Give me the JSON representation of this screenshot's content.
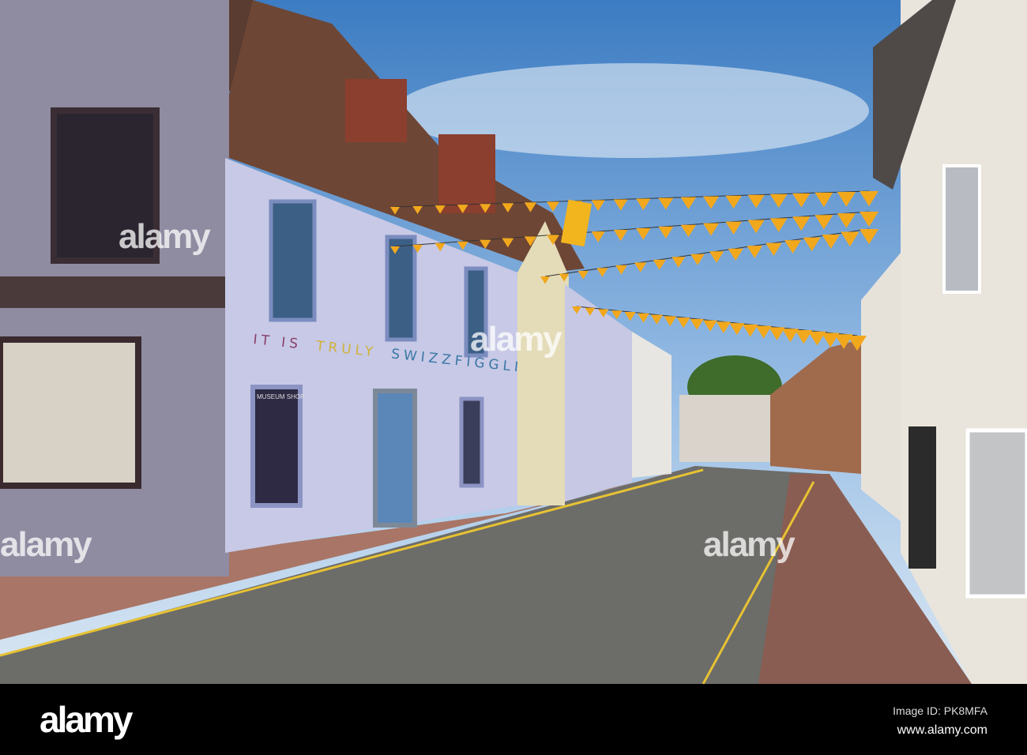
{
  "photo": {
    "wall_text_parts": [
      "IT IS",
      "TRULY",
      "SWIZZFIGGLINGLY!"
    ],
    "shop_sign": "MUSEUM SHOP",
    "watermark": "alamy",
    "colors": {
      "sky_top": "#3f7fc4",
      "sky_bottom": "#b9d3ec",
      "bunting": "#f2a81d",
      "road": "#6f6f6c",
      "building_lilac": "#c9cbe6",
      "building_grey": "#8e8aa0",
      "roof": "#6e4635"
    }
  },
  "footer": {
    "logo": "alamy",
    "image_id": "Image ID: PK8MFA",
    "url": "www.alamy.com"
  }
}
